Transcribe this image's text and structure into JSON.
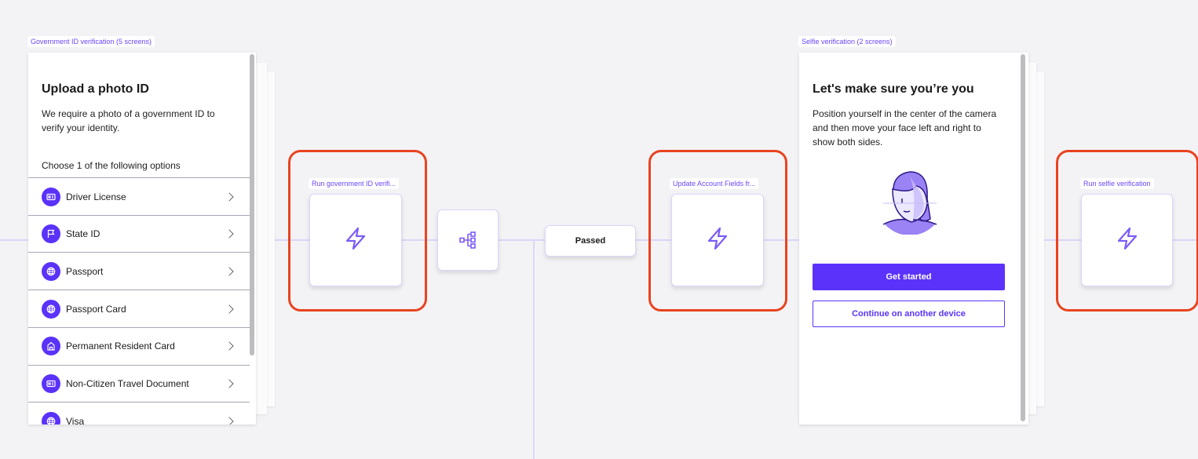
{
  "gov_id": {
    "tag": "Government ID verification (5 screens)",
    "title": "Upload a photo ID",
    "description_lines": [
      "We require a photo of a government ID to",
      "verify your identity."
    ],
    "prompt": "Choose 1 of the following options",
    "options": [
      {
        "label": "Driver License",
        "icon": "id-card-icon"
      },
      {
        "label": "State ID",
        "icon": "flag-icon"
      },
      {
        "label": "Passport",
        "icon": "globe-icon"
      },
      {
        "label": "Passport Card",
        "icon": "globe-icon"
      },
      {
        "label": "Permanent Resident Card",
        "icon": "home-icon"
      },
      {
        "label": "Non-Citizen Travel Document",
        "icon": "id-card-icon"
      },
      {
        "label": "Visa",
        "icon": "globe-icon"
      }
    ]
  },
  "action_nodes": [
    {
      "tag": "Run government ID verifi...",
      "icon": "lightning-icon"
    },
    {
      "tag": "Update Account Fields fr...",
      "icon": "lightning-icon"
    },
    {
      "tag": "Run selfie verification",
      "icon": "lightning-icon"
    }
  ],
  "branch_node": {
    "icon": "branch-icon"
  },
  "passed_label": "Passed",
  "selfie": {
    "tag": "Selfie verification (2 screens)",
    "title": "Let's make sure you’re you",
    "description_lines": [
      "Position yourself in the center of the camera",
      "and then move your face left and right to",
      "show both sides."
    ],
    "primary_button": "Get started",
    "secondary_button": "Continue on another device"
  },
  "colors": {
    "accent": "#5a32fa",
    "highlight": "#e8441f",
    "background": "#f3f3f6",
    "connector": "#dcd5f7"
  }
}
